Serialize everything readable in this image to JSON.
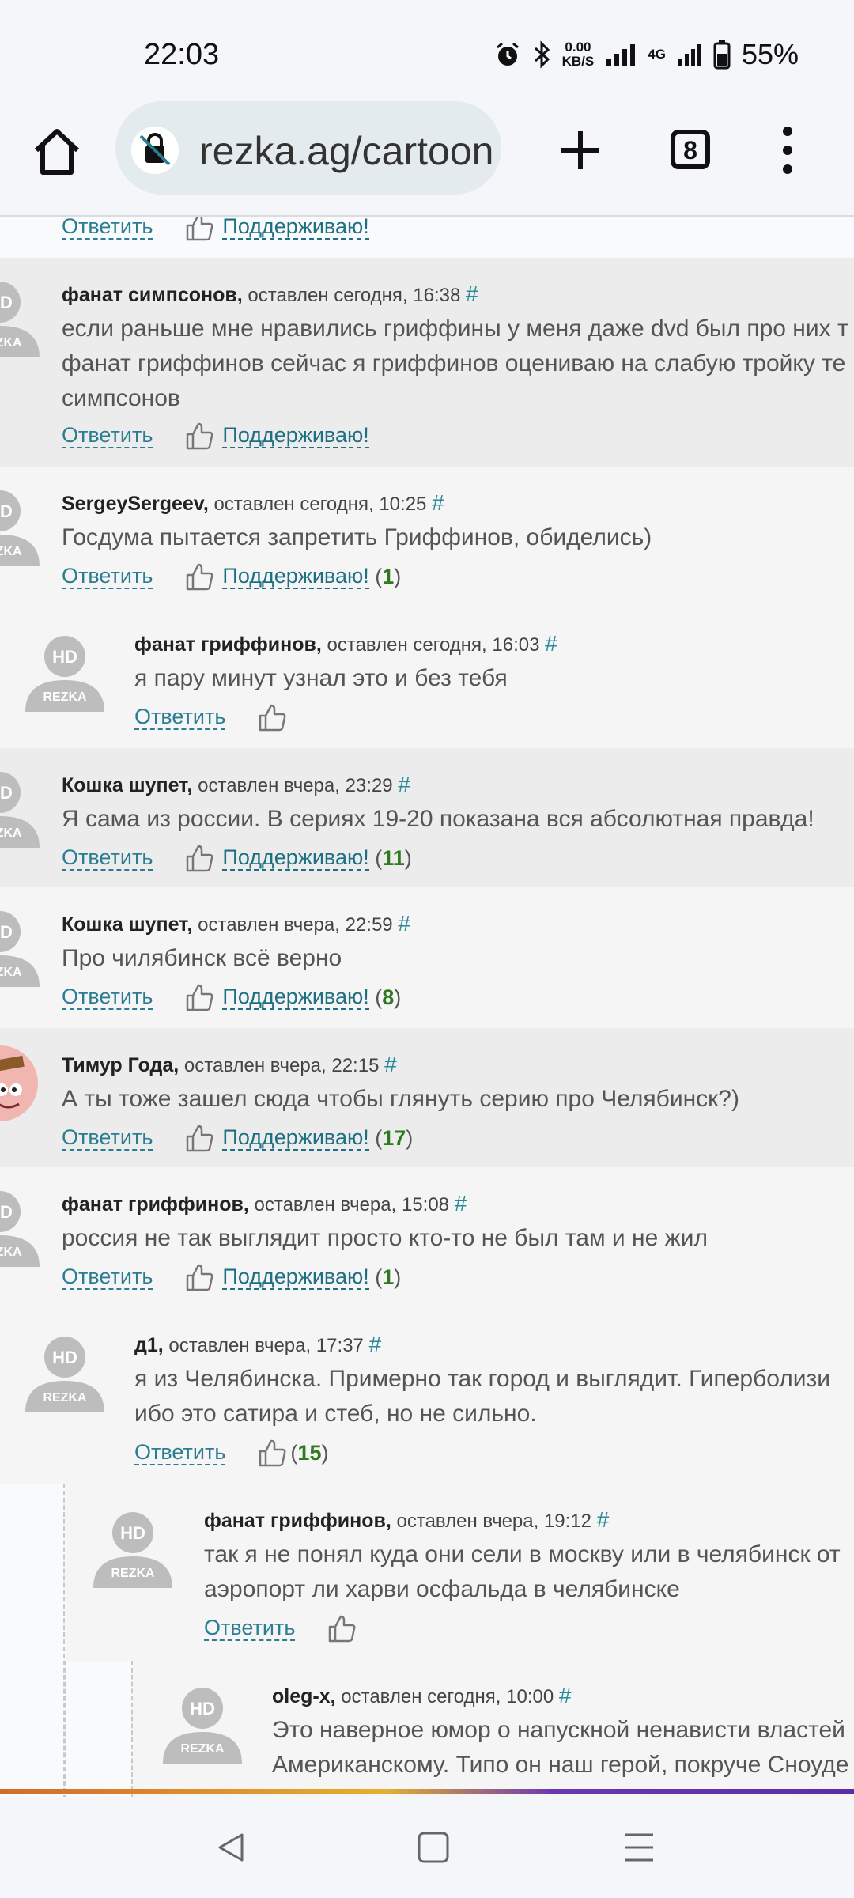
{
  "status_bar": {
    "time": "22:03",
    "net_speed": "0.00",
    "net_unit": "KB/S",
    "network": "4G",
    "battery": "55%"
  },
  "browser": {
    "url": "rezka.ag/cartoon",
    "tab_count": "8"
  },
  "labels": {
    "reply": "Ответить",
    "support": "Поддерживаю!"
  },
  "top_partial": {
    "reply": "Ответить",
    "support": "Поддерживаю!"
  },
  "comments": [
    {
      "author": "фанат симпсонов,",
      "meta": "оставлен сегодня, 16:38",
      "lines": [
        "если раньше мне нравились гриффины у меня даже dvd был про них т",
        "фанат гриффинов сейчас я гриффинов оцениваю на слабую тройку те",
        "симпсонов"
      ],
      "likes": ""
    },
    {
      "author": "SergeySergeev,",
      "meta": "оставлен сегодня, 10:25",
      "lines": [
        "Госдума пытается запретить Гриффинов, обиделись)"
      ],
      "likes": "1"
    },
    {
      "author": "фанат гриффинов,",
      "meta": "оставлен сегодня, 16:03",
      "lines": [
        "я пару минут узнал это и без тебя"
      ],
      "likes": ""
    },
    {
      "author": "Кошка шупет,",
      "meta": "оставлен вчера, 23:29",
      "lines": [
        "Я сама из россии. В сериях 19-20 показана вся абсолютная правда!"
      ],
      "likes": "11"
    },
    {
      "author": "Кошка шупет,",
      "meta": "оставлен вчера, 22:59",
      "lines": [
        "Про чилябинск всё верно"
      ],
      "likes": "8"
    },
    {
      "author": "Тимур Года,",
      "meta": "оставлен вчера, 22:15",
      "lines": [
        "А ты тоже зашел сюда чтобы глянуть серию про Челябинск?)"
      ],
      "likes": "17"
    },
    {
      "author": "фанат гриффинов,",
      "meta": "оставлен вчера, 15:08",
      "lines": [
        "россия не так выглядит просто кто-то не был там и не жил"
      ],
      "likes": "1"
    },
    {
      "author": "д1,",
      "meta": "оставлен вчера, 17:37",
      "lines": [
        "я из Челябинска. Примерно так город и выглядит. Гиперболизи",
        "ибо это сатира и стеб, но не сильно."
      ],
      "likes": "15"
    },
    {
      "author": "фанат гриффинов,",
      "meta": "оставлен вчера, 19:12",
      "lines": [
        "так я не понял куда они сели в москву или в челябинск от",
        "аэропорт ли харви осфальда в челябинске"
      ],
      "likes": ""
    },
    {
      "author": "oleg-x,",
      "meta": "оставлен сегодня, 10:00",
      "lines": [
        "Это наверное юмор о напускной ненависти властей",
        "Американскому. Типо он наш герой, покруче Сноуде"
      ],
      "likes": ""
    }
  ],
  "avatar_text": {
    "hd": "HD",
    "rezka": "REZKA",
    "hd_partial": "D",
    "rezka_partial": "KA"
  },
  "hash": "#"
}
